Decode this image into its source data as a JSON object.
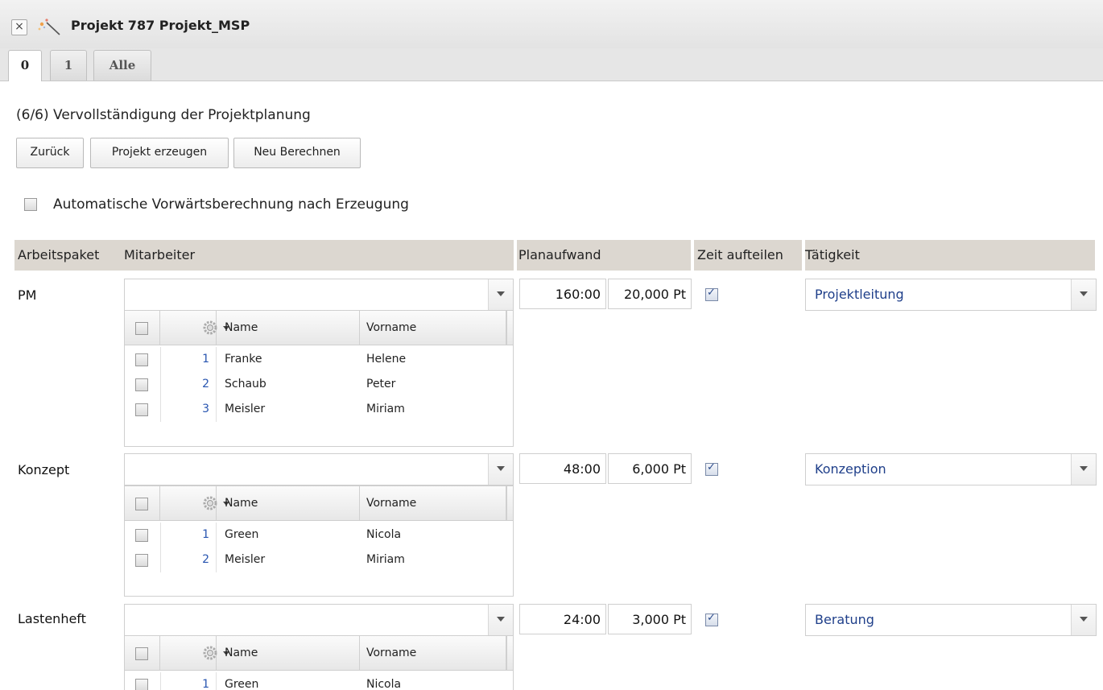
{
  "window": {
    "title": "Projekt 787 Projekt_MSP"
  },
  "tabs": [
    {
      "label": "0"
    },
    {
      "label": "1"
    },
    {
      "label": "Alle"
    }
  ],
  "page": {
    "heading": "(6/6) Vervollständigung der Projektplanung",
    "buttons": {
      "back": "Zurück",
      "create": "Projekt erzeugen",
      "recalc": "Neu Berechnen"
    },
    "auto_forward_label": "Automatische Vorwärtsberechnung nach Erzeugung",
    "auto_forward_checked": false
  },
  "table_header": {
    "arbeitspaket": "Arbeitspaket",
    "mitarbeiter": "Mitarbeiter",
    "planaufwand": "Planaufwand",
    "zeit_aufteilen": "Zeit aufteilen",
    "taetigkeit": "Tätigkeit"
  },
  "grid_columns": {
    "name": "Name",
    "vorname": "Vorname"
  },
  "packages": [
    {
      "name": "PM",
      "employee_value": "",
      "hours": "160:00",
      "points": "20,000 Pt",
      "split_time": true,
      "activity": "Projektleitung",
      "employees": [
        {
          "nr": "1",
          "name": "Franke",
          "vorname": "Helene"
        },
        {
          "nr": "2",
          "name": "Schaub",
          "vorname": "Peter"
        },
        {
          "nr": "3",
          "name": "Meisler",
          "vorname": "Miriam"
        }
      ]
    },
    {
      "name": "Konzept",
      "employee_value": "",
      "hours": "48:00",
      "points": "6,000 Pt",
      "split_time": true,
      "activity": "Konzeption",
      "employees": [
        {
          "nr": "1",
          "name": "Green",
          "vorname": "Nicola"
        },
        {
          "nr": "2",
          "name": "Meisler",
          "vorname": "Miriam"
        }
      ]
    },
    {
      "name": "Lastenheft",
      "employee_value": "",
      "hours": "24:00",
      "points": "3,000 Pt",
      "split_time": true,
      "activity": "Beratung",
      "employees": [
        {
          "nr": "1",
          "name": "Green",
          "vorname": "Nicola"
        }
      ]
    }
  ]
}
